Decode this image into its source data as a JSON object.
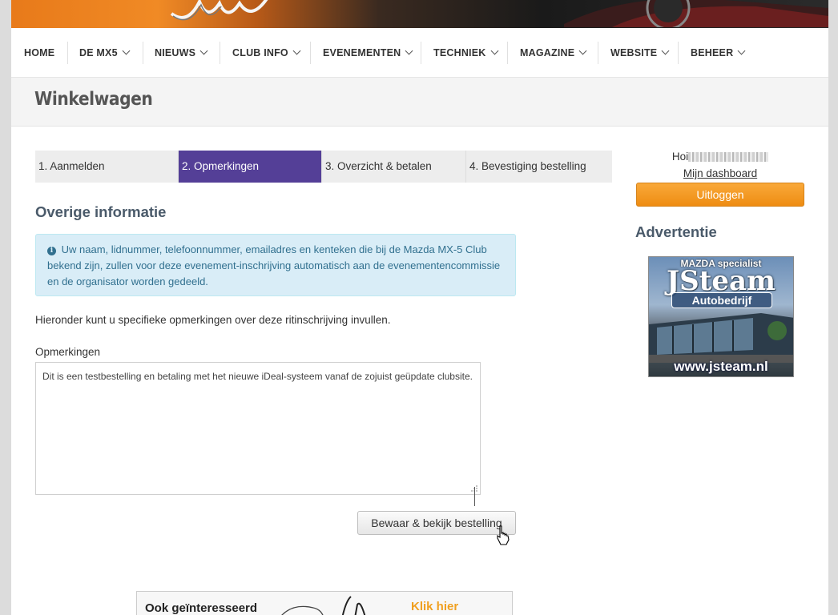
{
  "nav": {
    "items": [
      {
        "label": "HOME"
      },
      {
        "label": "DE MX5"
      },
      {
        "label": "NIEUWS"
      },
      {
        "label": "CLUB INFO"
      },
      {
        "label": "EVENEMENTEN"
      },
      {
        "label": "TECHNIEK"
      },
      {
        "label": "MAGAZINE"
      },
      {
        "label": "WEBSITE"
      },
      {
        "label": "BEHEER"
      }
    ]
  },
  "page": {
    "title": "Winkelwagen"
  },
  "steps": [
    {
      "label": "1. Aanmelden",
      "active": false
    },
    {
      "label": "2. Opmerkingen",
      "active": true
    },
    {
      "label": "3. Overzicht & betalen",
      "active": false
    },
    {
      "label": "4. Bevestiging bestelling",
      "active": false
    }
  ],
  "main": {
    "section_title": "Overige informatie",
    "info_text": "Uw naam, lidnummer, telefoonnummer, emailadres en kenteken die bij de Mazda MX-5 Club bekend zijn, zullen voor deze evenement-inschrijving automatisch aan de evenementencommissie en de organisator worden gedeeld.",
    "intro": "Hieronder kunt u specifieke opmerkingen over deze ritinschrijving invullen.",
    "remarks_label": "Opmerkingen",
    "remarks_value": "Dit is een testbestelling en betaling met het nieuwe iDeal-systeem vanaf de zojuist geüpdate clubsite.",
    "save_button": "Bewaar & bekijk bestelling"
  },
  "promo": {
    "text": "Ook geïnteresseerd",
    "link": "Klik hier"
  },
  "sidebar": {
    "greeting": "Hoi",
    "dashboard_link": "Mijn dashboard",
    "logout_button": "Uitloggen",
    "ad_title": "Advertentie",
    "ad": {
      "top_text": "MAZDA specialist",
      "logo_text": "JSteam",
      "sub_text": "Autobedrijf",
      "url": "www.jsteam.nl"
    }
  },
  "colors": {
    "step_active": "#543f97",
    "info_bg": "#d9edf7",
    "info_text": "#31708f",
    "logout_bg": "#f39c1f",
    "heading": "#4a5a6a",
    "promo_link": "#f0a020"
  }
}
